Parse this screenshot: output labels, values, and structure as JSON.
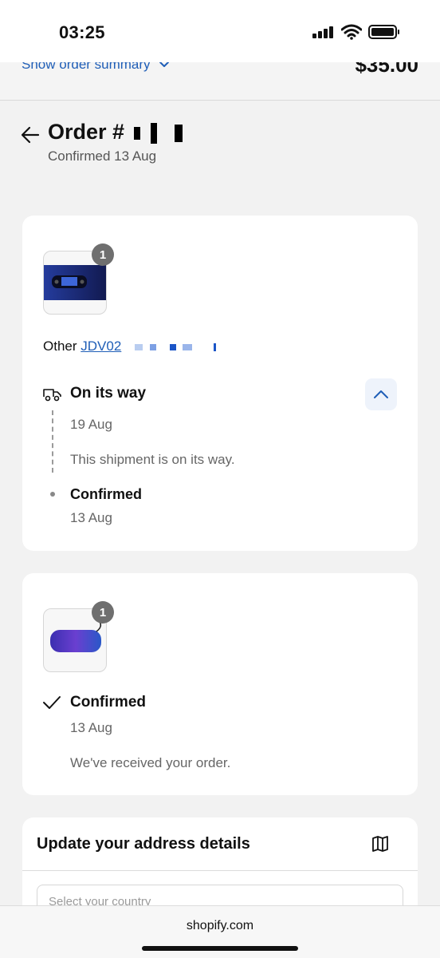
{
  "status_bar": {
    "time": "03:25"
  },
  "summary": {
    "toggle_label": "Show order summary",
    "total": "$35.00"
  },
  "order": {
    "title_prefix": "Order #",
    "subtitle": "Confirmed 13 Aug"
  },
  "shipment1": {
    "quantity": "1",
    "product_prefix": "Other",
    "product_link": "JDV02",
    "status_title": "On its way",
    "status_date": "19 Aug",
    "status_message": "This shipment is on its way.",
    "confirmed_title": "Confirmed",
    "confirmed_date": "13 Aug"
  },
  "shipment2": {
    "quantity": "1",
    "status_title": "Confirmed",
    "status_date": "13 Aug",
    "status_message": "We've received your order."
  },
  "address": {
    "title": "Update your address details",
    "country_placeholder": "Select your country"
  },
  "footer": {
    "domain": "shopify.com"
  },
  "colors": {
    "link": "#1f5eb7",
    "badge": "#6f6f6f",
    "page_bg": "#f2f2f2"
  },
  "icons": [
    "signal-icon",
    "wifi-icon",
    "battery-icon",
    "chevron-down-icon",
    "back-arrow-icon",
    "truck-icon",
    "chevron-up-icon",
    "checkmark-icon",
    "map-icon"
  ]
}
